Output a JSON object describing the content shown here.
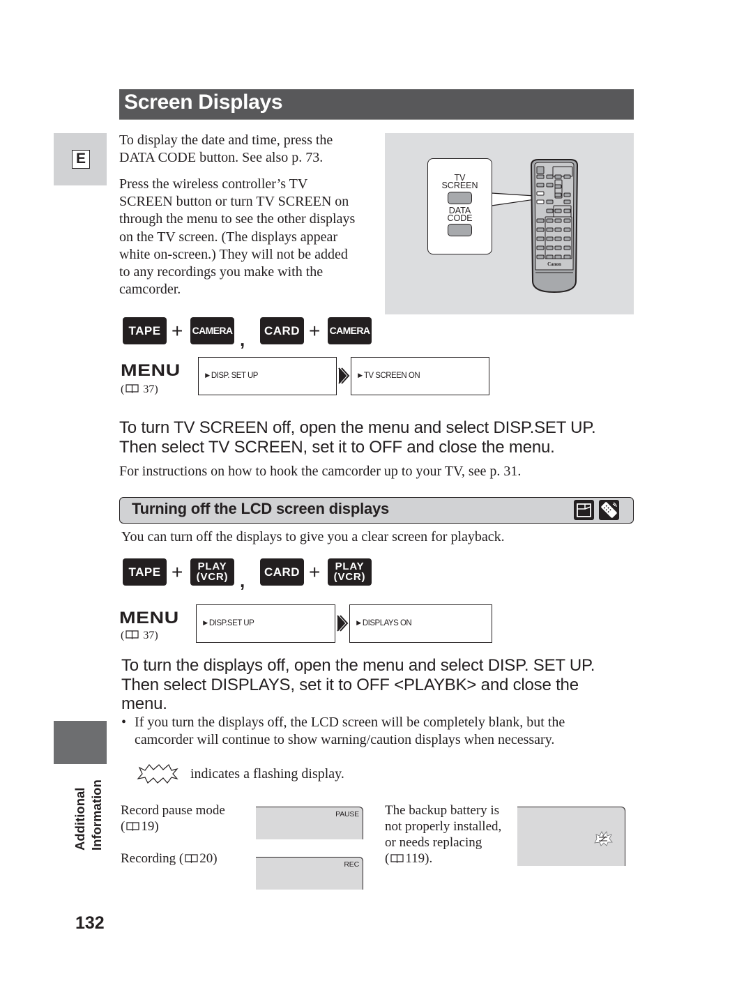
{
  "page": {
    "title": "Screen Displays",
    "language_tab": "E",
    "section_label": [
      "Additional",
      "Information"
    ],
    "page_number": "132"
  },
  "intro": {
    "para1": [
      "To display the date and time, press the",
      "DATA CODE button. See also p. 73."
    ],
    "para2": [
      "Press the wireless controller’s TV",
      "SCREEN button or turn TV SCREEN on",
      "through the menu to see the other displays",
      "on the TV screen. (The displays appear",
      "white on-screen.) They will not be added",
      "to any recordings you make with the",
      "camcorder."
    ]
  },
  "illustration": {
    "callout_labels": {
      "tv_screen": [
        "TV",
        "SCREEN"
      ],
      "data_code": [
        "DATA",
        "CODE"
      ]
    },
    "remote_brand": "Canon"
  },
  "section1": {
    "modes": [
      {
        "dial": "TAPE",
        "mode": "CAMERA"
      },
      {
        "dial": "CARD",
        "mode": "CAMERA"
      }
    ],
    "menu_label": "MENU",
    "menu_ref": "37",
    "menu_steps": [
      "►DISP. SET UP",
      "►TV SCREEN   ON"
    ],
    "instruction": [
      "To turn TV SCREEN off, open the menu and select DISP.SET UP.",
      "Then select TV SCREEN, set it to OFF and close the menu."
    ],
    "note": "For instructions on how to hook the camcorder up to your TV, see p. 31."
  },
  "section2": {
    "heading": "Turning off the LCD screen displays",
    "heading_icons": [
      "camcorder-icon",
      "wireless-controller-icon"
    ],
    "intro": "You can turn off the displays to give you a clear screen for playback.",
    "modes": [
      {
        "dial": "TAPE",
        "mode": [
          "PLAY",
          "(VCR)"
        ]
      },
      {
        "dial": "CARD",
        "mode": [
          "PLAY",
          "(VCR)"
        ]
      }
    ],
    "menu_label": "MENU",
    "menu_ref": "37",
    "menu_steps": [
      "►DISP.SET UP",
      "►DISPLAYS   ON"
    ],
    "instruction": [
      "To turn the displays off, open the menu and select DISP. SET UP.",
      "Then select DISPLAYS, set it to OFF <PLAYBK> and close the",
      "menu."
    ],
    "bullet": [
      "If you turn the displays off, the LCD screen will be completely blank, but the",
      "camcorder will continue to show warning/caution displays when necessary."
    ],
    "flash_legend": "indicates a flashing display."
  },
  "warnings": [
    {
      "desc": [
        "Record pause mode",
        "("
      ],
      "ref": "19",
      "screen_text": "PAUSE"
    },
    {
      "desc": [
        "Recording ("
      ],
      "ref": "20",
      "screen_text": "REC"
    },
    {
      "desc": [
        "The backup battery is",
        "not properly installed,",
        "or needs replacing",
        "("
      ],
      "ref": "119",
      "ref_suffix": ").",
      "screen_icon": "backup-battery-flashing-icon"
    }
  ],
  "colors": {
    "title_bar": "#58585a",
    "tab_gray": "#d1d2d4",
    "section_tab": "#6d6e70",
    "key_black": "#231f20",
    "screen_gray": "#d9d9da",
    "illustration_bg": "#dcdddf"
  }
}
